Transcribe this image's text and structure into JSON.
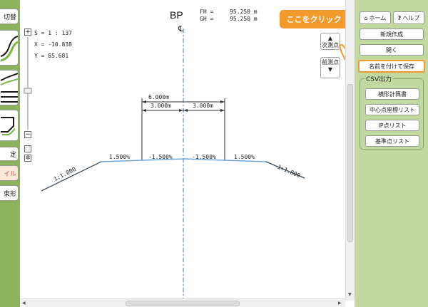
{
  "left_toolbar": {
    "switch_label": "切替",
    "setting_label": "定",
    "file_label": "イル",
    "shape_label": "束形"
  },
  "canvas": {
    "scale": "S = 1 : 137",
    "x_coord": "X = -10.838",
    "y_coord": "Y = 85.681",
    "station": "BP",
    "fh": "FH =",
    "fh_value": "95.250 m",
    "gh": "GH =",
    "gh_value": "95.250 m",
    "centerline": "℄",
    "next_point": "次測点",
    "prev_point": "前測点",
    "callout": "ここをクリック",
    "dim_total": "6.000m",
    "dim_left": "3.000m",
    "dim_right": "3.000m",
    "slope_ll": "1.500%",
    "slope_lc": "-1.500%",
    "slope_rc": "-1.500%",
    "slope_rr": "1.500%",
    "bank_left": "1:1.800",
    "bank_right": "1:1.800"
  },
  "right_panel": {
    "home": "ホーム",
    "help": "ヘルプ",
    "new": "新規作成",
    "open": "開く",
    "save_as": "名前を付けて保存",
    "csv_title": "CSV出力",
    "csv_items": [
      "横形計算書",
      "中心点座標リスト",
      "IP点リスト",
      "基準点リスト"
    ]
  },
  "colors": {
    "left_bar": "#8bb35a",
    "right_panel": "#c1d9a0",
    "accent": "#f39a2c",
    "surface_line": "#6fa8dc"
  }
}
